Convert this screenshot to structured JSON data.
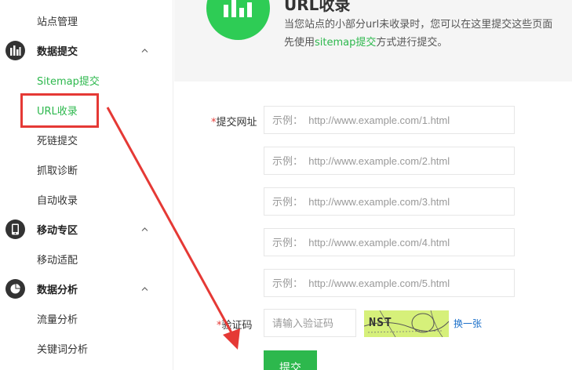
{
  "sidebar": {
    "items": [
      {
        "label": "站点管理",
        "type": "sub"
      },
      {
        "label": "数据提交",
        "type": "group",
        "icon": "bar-chart-icon"
      },
      {
        "label": "Sitemap提交",
        "type": "sub"
      },
      {
        "label": "URL收录",
        "type": "sub",
        "active": true
      },
      {
        "label": "死链提交",
        "type": "sub"
      },
      {
        "label": "抓取诊断",
        "type": "sub"
      },
      {
        "label": "自动收录",
        "type": "sub"
      },
      {
        "label": "移动专区",
        "type": "group",
        "icon": "mobile-phone-icon"
      },
      {
        "label": "移动适配",
        "type": "sub"
      },
      {
        "label": "数据分析",
        "type": "group",
        "icon": "pie-chart-icon"
      },
      {
        "label": "流量分析",
        "type": "sub"
      },
      {
        "label": "关键词分析",
        "type": "sub"
      }
    ]
  },
  "header": {
    "title": "URL收录",
    "desc_line1": "当您站点的小部分url未收录时，您可以在这里提交这些页面",
    "desc_line2_pre": "先使用",
    "desc_line2_link": "sitemap提交",
    "desc_line2_post": "方式进行提交。"
  },
  "form": {
    "url_label_req": "*",
    "url_label": "提交网址",
    "url_inputs": [
      {
        "placeholder": "示例：  http://www.example.com/1.html",
        "value": ""
      },
      {
        "placeholder": "示例：  http://www.example.com/2.html",
        "value": ""
      },
      {
        "placeholder": "示例：  http://www.example.com/3.html",
        "value": ""
      },
      {
        "placeholder": "示例：  http://www.example.com/4.html",
        "value": ""
      },
      {
        "placeholder": "示例：  http://www.example.com/5.html",
        "value": ""
      }
    ],
    "captcha_label_req": "*",
    "captcha_label": "验证码",
    "captcha_placeholder": "请输入验证码",
    "captcha_text": "NST",
    "refresh_label": "换一张",
    "submit_label": "提交"
  },
  "colors": {
    "accent": "#2db84d",
    "highlight": "#e53935",
    "link": "#1a6fc9"
  }
}
